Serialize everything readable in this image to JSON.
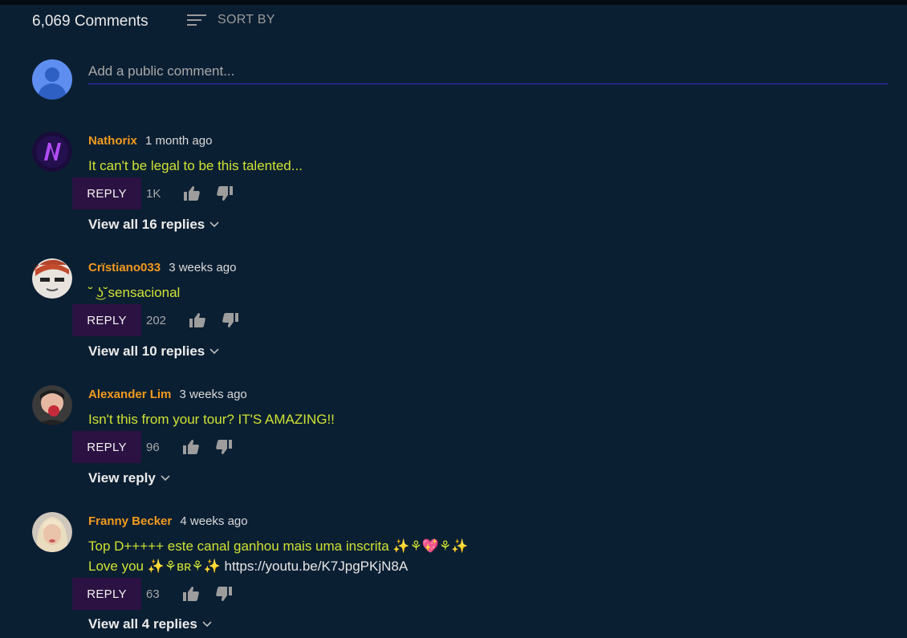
{
  "header": {
    "comment_count": "6,069 Comments",
    "sort_label": "SORT BY"
  },
  "composer": {
    "placeholder": "Add a public comment..."
  },
  "comments": [
    {
      "author": "Nathorix",
      "time": "1 month ago",
      "text": "It can't be legal to be this talented...",
      "reply_label": "REPLY",
      "likes": "1K",
      "replies_label": "View all 16 replies"
    },
    {
      "author": "Crïstiano033",
      "time": "3 weeks ago",
      "text": "˘ ͜ʖ˘sensacional",
      "reply_label": "REPLY",
      "likes": "202",
      "replies_label": "View all 10 replies"
    },
    {
      "author": "Alexander Lim",
      "time": "3 weeks ago",
      "text": "Isn't this from your tour? IT'S AMAZING!!",
      "reply_label": "REPLY",
      "likes": "96",
      "replies_label": "View reply"
    },
    {
      "author": "Franny Becker",
      "time": "4 weeks ago",
      "text_line1": "Top D+++++ este canal ganhou mais uma inscrita ✨⚘💖⚘✨",
      "text_line2": "Love you ✨⚘ʙʀ⚘✨ ",
      "link": "https://youtu.be/K7JpgPKjN8A",
      "reply_label": "REPLY",
      "likes": "63",
      "replies_label": "View all 4 replies"
    }
  ],
  "colors": {
    "background": "#0b1f33",
    "author": "#f29a1d",
    "comment_text": "#cfe233",
    "reply_button": "#2b1242",
    "input_underline": "#3d2ad6"
  }
}
